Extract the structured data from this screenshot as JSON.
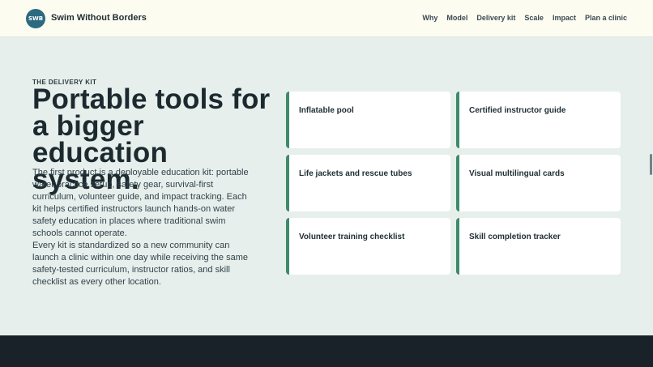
{
  "header": {
    "logo_text": "SWB",
    "brand": "Swim Without Borders",
    "nav": [
      "Why",
      "Model",
      "Delivery kit",
      "Scale",
      "Impact",
      "Plan a clinic"
    ]
  },
  "section": {
    "eyebrow": "THE DELIVERY KIT",
    "headline": "Portable tools for a bigger education system.",
    "paragraphs": [
      "The first product is a deployable education kit: portable water practice setup, safety gear, survival-first curriculum, volunteer guide, and impact tracking. Each kit helps certified instructors launch hands-on water safety education in places where traditional swim schools cannot operate.",
      "Every kit is standardized so a new community can launch a clinic within one day while receiving the same safety-tested curriculum, instructor ratios, and skill checklist as every other location."
    ]
  },
  "kit_items": [
    "Inflatable pool",
    "Certified instructor guide",
    "Life jackets and rescue tubes",
    "Visual multilingual cards",
    "Volunteer training checklist",
    "Skill completion tracker"
  ],
  "colors": {
    "page_bg": "#e6efec",
    "header_bg": "#fdfcf1",
    "accent": "#3f8a6a",
    "logo_bg": "#2c6a80",
    "footer_bg": "#192228"
  }
}
